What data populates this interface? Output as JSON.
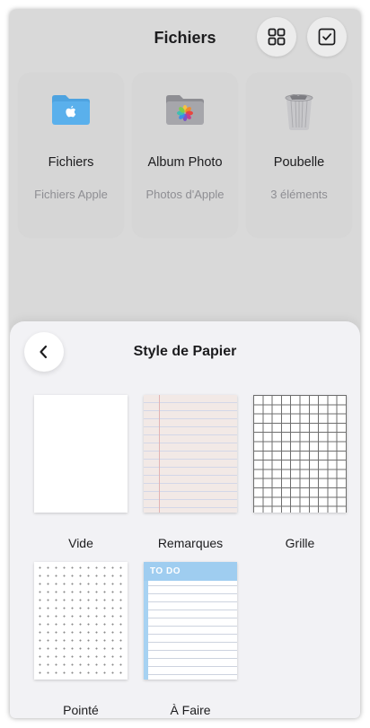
{
  "header": {
    "title": "Fichiers",
    "grid_icon": "grid-icon",
    "select_icon": "checkbox-icon"
  },
  "locations": [
    {
      "name": "Fichiers",
      "subtitle": "Fichiers Apple",
      "icon": "blue-folder-icon"
    },
    {
      "name": "Album Photo",
      "subtitle": "Photos d'Apple",
      "icon": "photos-folder-icon"
    },
    {
      "name": "Poubelle",
      "subtitle": "3 éléments",
      "icon": "trash-icon"
    }
  ],
  "sheet": {
    "title": "Style de Papier",
    "back_icon": "chevron-left-icon",
    "papers": [
      {
        "label": "Vide"
      },
      {
        "label": "Remarques"
      },
      {
        "label": "Grille"
      },
      {
        "label": "Pointé"
      },
      {
        "label": "À Faire",
        "header_text": "TO DO"
      }
    ]
  },
  "colors": {
    "background_dim": "#d9d9d9",
    "sheet_background": "#f2f2f5",
    "folder_blue": "#5ab0ec",
    "todo_blue": "#9fcdf0"
  }
}
